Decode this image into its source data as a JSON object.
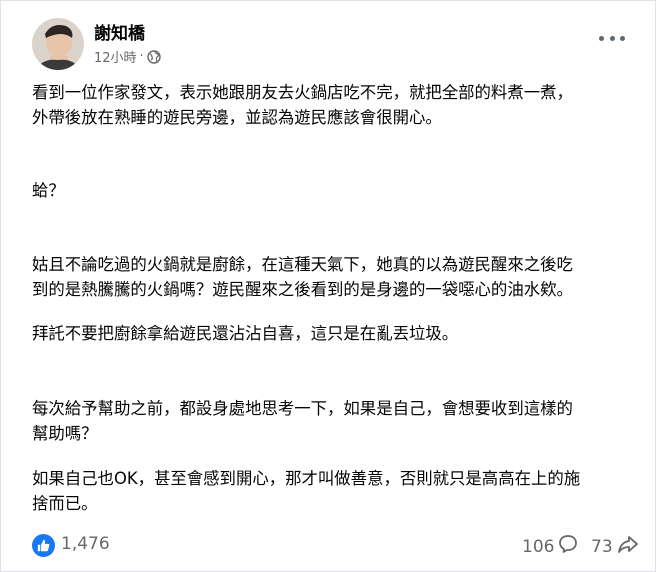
{
  "post": {
    "author": "謝知橋",
    "timestamp": "12小時",
    "separator": "·",
    "privacy_icon": "globe-icon",
    "menu_icon": "more-options-icon",
    "paragraphs": [
      "看到一位作家發文，表示她跟朋友去火鍋店吃不完，就把全部的料煮一煮，\n外帶後放在熟睡的遊民旁邊，並認為遊民應該會很開心。",
      "蛤？",
      "姑且不論吃過的火鍋就是廚餘，在這種天氣下，她真的以為遊民醒來之後吃\n到的是熱騰騰的火鍋嗎？遊民醒來之後看到的是身邊的一袋噁心的油水欸。",
      "拜託不要把廚餘拿給遊民還沾沾自喜，這只是在亂丟垃圾。",
      "每次給予幫助之前，都設身處地思考一下，如果是自己，會想要收到這樣的\n幫助嗎？",
      "如果自己也OK，甚至會感到開心，那才叫做善意，否則就只是高高在上的施\n捨而已。"
    ]
  },
  "footer": {
    "like_icon": "thumbs-up-icon",
    "likes": "1,476",
    "comments": "106",
    "comment_icon": "comment-bubble-icon",
    "shares": "73",
    "share_icon": "share-arrow-icon"
  },
  "colors": {
    "text": "#050505",
    "secondary": "#65676b",
    "like_blue": "#1877f2",
    "border": "#dfe1e5"
  }
}
